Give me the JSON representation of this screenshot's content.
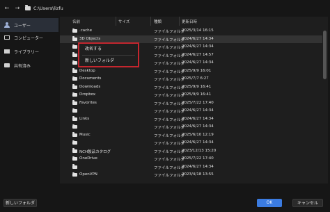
{
  "address": {
    "path": "C:\\Users\\lizfu"
  },
  "sidebar": {
    "items": [
      {
        "label": "ユーザー"
      },
      {
        "label": "コンピューター"
      },
      {
        "label": "ライブラリー"
      },
      {
        "label": "共有済み"
      }
    ]
  },
  "columns": {
    "name": "名前",
    "size": "サイズ",
    "type": "種類",
    "date": "更新日時"
  },
  "files": [
    {
      "name": ".cache",
      "type": "ファイルフォルダ",
      "date": "2025/3/14 16:15"
    },
    {
      "name": "3D Objects",
      "type": "ファイルフォルダ",
      "date": "2024/6/27 14:34"
    },
    {
      "name": "",
      "type": "ファイルフォルダ",
      "date": "2024/6/27 14:34"
    },
    {
      "name": "",
      "type": "ファイルフォルダ",
      "date": "2024/6/27 14:57"
    },
    {
      "name": "",
      "type": "ファイルフォルダ",
      "date": "2024/6/27 14:34"
    },
    {
      "name": "Desktop",
      "type": "ファイルフォルダ",
      "date": "2025/9/9 16:01"
    },
    {
      "name": "Documents",
      "type": "ファイルフォルダ",
      "date": "2025/7/7 6:27"
    },
    {
      "name": "Downloads",
      "type": "ファイルフォルダ",
      "date": "2025/9/9 16:41"
    },
    {
      "name": "Dropbox",
      "type": "ファイルフォルダ",
      "date": "2025/9/9 16:41"
    },
    {
      "name": "Favorites",
      "type": "ファイルフォルダ",
      "date": "2025/7/22 17:40"
    },
    {
      "name": "",
      "type": "ファイルフォルダ",
      "date": "2024/6/27 14:34"
    },
    {
      "name": "Links",
      "type": "ファイルフォルダ",
      "date": "2024/6/27 14:34"
    },
    {
      "name": "",
      "type": "ファイルフォルダ",
      "date": "2024/6/27 14:34"
    },
    {
      "name": "Music",
      "type": "ファイルフォルダ",
      "date": "2025/6/10 12:19"
    },
    {
      "name": "",
      "type": "ファイルフォルダ",
      "date": "2024/6/27 14:34"
    },
    {
      "name": "NCH製品カタログ",
      "type": "ファイルフォルダ",
      "date": "2023/12/13 15:20"
    },
    {
      "name": "OneDrive",
      "type": "ファイルフォルダ",
      "date": "2025/7/22 17:40"
    },
    {
      "name": "",
      "type": "ファイルフォルダ",
      "date": "2024/6/27 14:34"
    },
    {
      "name": "OpenVPN",
      "type": "ファイルフォルダ",
      "date": "2023/4/18 13:55"
    }
  ],
  "context_menu": {
    "rename": "改名する",
    "new_folder": "新しいフォルダ"
  },
  "buttons": {
    "new_folder": "新しいフォルダ",
    "ok": "OK",
    "cancel": "キャンセル"
  }
}
